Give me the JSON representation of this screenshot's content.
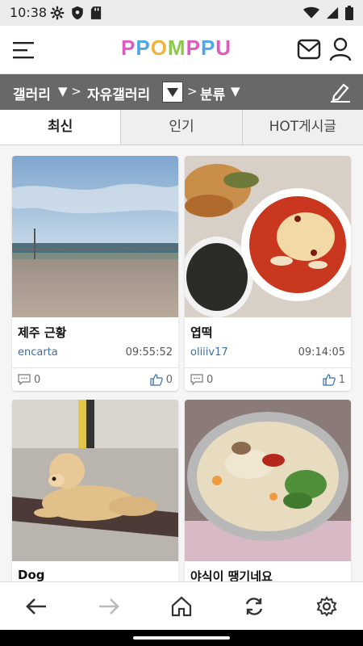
{
  "status_bar": {
    "time": "10:38",
    "left_icons": [
      "gear-icon",
      "shield-icon",
      "sd-card-icon"
    ],
    "right_icons": [
      "wifi-icon",
      "signal-icon",
      "battery-icon"
    ]
  },
  "header": {
    "logo_text": "PPOMPPU",
    "logo_colors": [
      "#e05ac0",
      "#4da8e8",
      "#f0b23a",
      "#8cc84b",
      "#e05ac0",
      "#4da8e8",
      "#e05ac0"
    ]
  },
  "breadcrumb": {
    "item1": "갤러리",
    "sep1": "▼ >",
    "item2": "자유갤러리",
    "drop_glyph": "▼",
    "sep2": ">",
    "item3": "분류",
    "drop3": "▼"
  },
  "tabs": [
    {
      "label": "최신",
      "active": true
    },
    {
      "label": "인기",
      "active": false
    },
    {
      "label": "HOT게시글",
      "active": false
    }
  ],
  "cards": [
    {
      "title": "제주 근황",
      "author": "encarta",
      "time": "09:55:52",
      "comments": "0",
      "likes": "0"
    },
    {
      "title": "엽떡",
      "author": "oliiiv17",
      "time": "09:14:05",
      "comments": "0",
      "likes": "1"
    },
    {
      "title": "Dog",
      "author": "",
      "time": "",
      "comments": "",
      "likes": ""
    },
    {
      "title": "야식이 땡기네요",
      "author": "",
      "time": "",
      "comments": "",
      "likes": ""
    }
  ],
  "bottom_nav": [
    "back-arrow-icon",
    "forward-arrow-icon",
    "home-icon",
    "refresh-icon",
    "settings-gear-icon"
  ],
  "colors": {
    "breadcrumb_bg": "#686868",
    "author_link": "#3b6ea5",
    "tab_inactive_bg": "#efefef"
  }
}
